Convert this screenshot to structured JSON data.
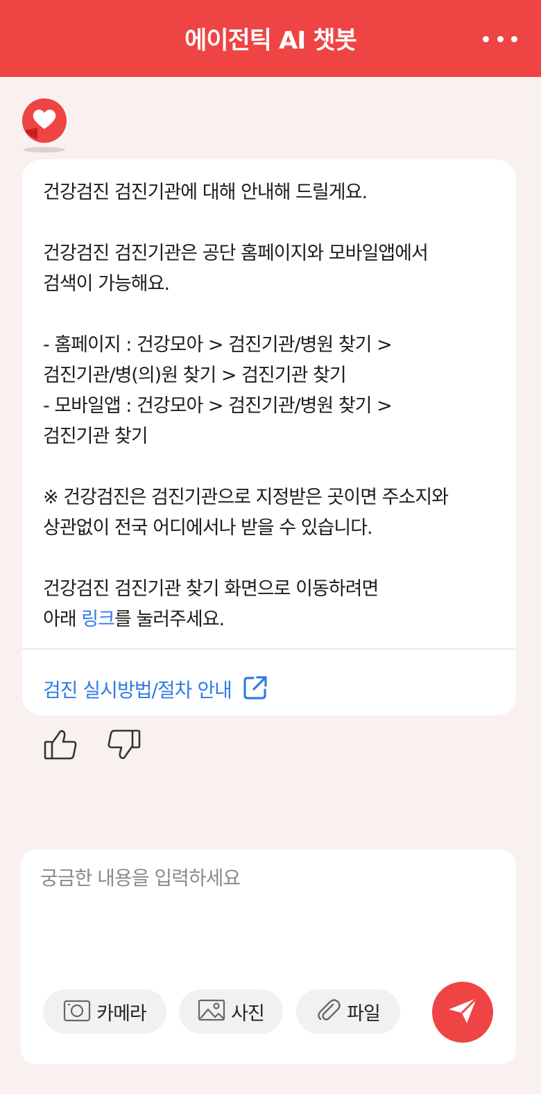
{
  "header": {
    "title": "에이전틱 AI 챗봇"
  },
  "message": {
    "lines": [
      "건강검진 검진기관에 대해 안내해 드릴게요.",
      "",
      "건강검진 검진기관은 공단 홈페이지와 모바일앱에서",
      "검색이 가능해요.",
      "",
      "- 홈페이지 : 건강모아 > 검진기관/병원 찾기 >",
      "검진기관/병(의)원 찾기 > 검진기관 찾기",
      "- 모바일앱 : 건강모아 > 검진기관/병원 찾기 >",
      "검진기관 찾기",
      "",
      "※ 건강검진은 검진기관으로 지정받은 곳이면 주소지와",
      "상관없이 전국 어디에서나 받을 수 있습니다.",
      "",
      "건강검진 검진기관 찾기 화면으로 이동하려면"
    ],
    "last_line_prefix": "아래 ",
    "last_line_link": "링크",
    "last_line_suffix": "를 눌러주세요.",
    "link_label": "검진 실시방법/절차 안내"
  },
  "composer": {
    "placeholder": "궁금한 내용을 입력하세요",
    "camera_label": "카메라",
    "photo_label": "사진",
    "file_label": "파일"
  },
  "colors": {
    "brand": "#ee4444",
    "link": "#2f7be6",
    "background": "#f8f1f0"
  },
  "icons": [
    "more-icon",
    "bot-avatar-icon",
    "external-link-icon",
    "thumbs-up-icon",
    "thumbs-down-icon",
    "camera-icon",
    "image-icon",
    "paperclip-icon",
    "send-icon"
  ]
}
